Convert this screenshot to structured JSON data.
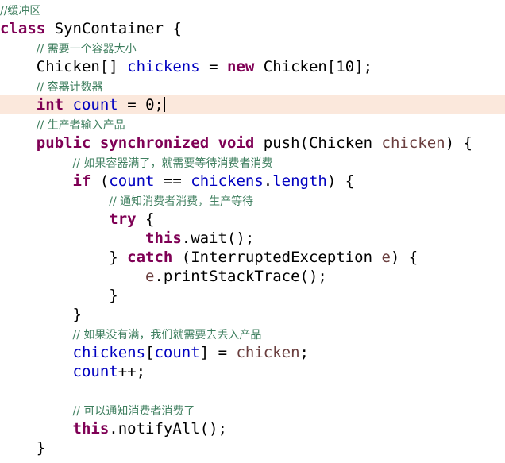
{
  "editor": {
    "lines": [
      {
        "tokens": [
          {
            "t": "//缓冲区",
            "c": "cmt"
          }
        ]
      },
      {
        "tokens": [
          {
            "t": "class",
            "c": "kw"
          },
          {
            "t": " SynContainer {",
            "c": "pln"
          }
        ]
      },
      {
        "tokens": [
          {
            "t": "    ",
            "c": "pln"
          },
          {
            "t": "// 需要一个容器大小",
            "c": "cmt"
          }
        ]
      },
      {
        "tokens": [
          {
            "t": "    Chicken[] ",
            "c": "pln"
          },
          {
            "t": "chickens",
            "c": "fld"
          },
          {
            "t": " = ",
            "c": "pln"
          },
          {
            "t": "new",
            "c": "kw"
          },
          {
            "t": " Chicken[10];",
            "c": "pln"
          }
        ]
      },
      {
        "tokens": [
          {
            "t": "    ",
            "c": "pln"
          },
          {
            "t": "// 容器计数器",
            "c": "cmt"
          }
        ]
      },
      {
        "tokens": [
          {
            "t": "    ",
            "c": "pln"
          },
          {
            "t": "int",
            "c": "kw"
          },
          {
            "t": " ",
            "c": "pln"
          },
          {
            "t": "count",
            "c": "fld"
          },
          {
            "t": " = 0;",
            "c": "pln"
          }
        ],
        "current": true,
        "caret": true
      },
      {
        "tokens": [
          {
            "t": "    ",
            "c": "pln"
          },
          {
            "t": "// 生产者输入产品",
            "c": "cmt"
          }
        ]
      },
      {
        "tokens": [
          {
            "t": "    ",
            "c": "pln"
          },
          {
            "t": "public",
            "c": "kw"
          },
          {
            "t": " ",
            "c": "pln"
          },
          {
            "t": "synchronized",
            "c": "kw"
          },
          {
            "t": " ",
            "c": "pln"
          },
          {
            "t": "void",
            "c": "kw"
          },
          {
            "t": " push(Chicken ",
            "c": "pln"
          },
          {
            "t": "chicken",
            "c": "loc"
          },
          {
            "t": ") {",
            "c": "pln"
          }
        ]
      },
      {
        "tokens": [
          {
            "t": "        ",
            "c": "pln"
          },
          {
            "t": "// 如果容器满了，就需要等待消费者消费",
            "c": "cmt"
          }
        ]
      },
      {
        "tokens": [
          {
            "t": "        ",
            "c": "pln"
          },
          {
            "t": "if",
            "c": "kw"
          },
          {
            "t": " (",
            "c": "pln"
          },
          {
            "t": "count",
            "c": "fld"
          },
          {
            "t": " == ",
            "c": "pln"
          },
          {
            "t": "chickens",
            "c": "fld"
          },
          {
            "t": ".",
            "c": "pln"
          },
          {
            "t": "length",
            "c": "fld"
          },
          {
            "t": ") {",
            "c": "pln"
          }
        ]
      },
      {
        "tokens": [
          {
            "t": "            ",
            "c": "pln"
          },
          {
            "t": "// 通知消费者消费，生产等待",
            "c": "cmt"
          }
        ]
      },
      {
        "tokens": [
          {
            "t": "            ",
            "c": "pln"
          },
          {
            "t": "try",
            "c": "kw"
          },
          {
            "t": " {",
            "c": "pln"
          }
        ]
      },
      {
        "tokens": [
          {
            "t": "                ",
            "c": "pln"
          },
          {
            "t": "this",
            "c": "kw"
          },
          {
            "t": ".wait();",
            "c": "pln"
          }
        ]
      },
      {
        "tokens": [
          {
            "t": "            } ",
            "c": "pln"
          },
          {
            "t": "catch",
            "c": "kw"
          },
          {
            "t": " (InterruptedException ",
            "c": "pln"
          },
          {
            "t": "e",
            "c": "loc"
          },
          {
            "t": ") {",
            "c": "pln"
          }
        ]
      },
      {
        "tokens": [
          {
            "t": "                ",
            "c": "pln"
          },
          {
            "t": "e",
            "c": "loc"
          },
          {
            "t": ".printStackTrace();",
            "c": "pln"
          }
        ]
      },
      {
        "tokens": [
          {
            "t": "            }",
            "c": "pln"
          }
        ]
      },
      {
        "tokens": [
          {
            "t": "        }",
            "c": "pln"
          }
        ]
      },
      {
        "tokens": [
          {
            "t": "        ",
            "c": "pln"
          },
          {
            "t": "// 如果没有满，我们就需要去丢入产品",
            "c": "cmt"
          }
        ]
      },
      {
        "tokens": [
          {
            "t": "        ",
            "c": "pln"
          },
          {
            "t": "chickens",
            "c": "fld"
          },
          {
            "t": "[",
            "c": "pln"
          },
          {
            "t": "count",
            "c": "fld"
          },
          {
            "t": "] = ",
            "c": "pln"
          },
          {
            "t": "chicken",
            "c": "loc"
          },
          {
            "t": ";",
            "c": "pln"
          }
        ]
      },
      {
        "tokens": [
          {
            "t": "        ",
            "c": "pln"
          },
          {
            "t": "count",
            "c": "fld"
          },
          {
            "t": "++;",
            "c": "pln"
          }
        ]
      },
      {
        "tokens": []
      },
      {
        "tokens": [
          {
            "t": "        ",
            "c": "pln"
          },
          {
            "t": "// 可以通知消费者消费了",
            "c": "cmt"
          }
        ]
      },
      {
        "tokens": [
          {
            "t": "        ",
            "c": "pln"
          },
          {
            "t": "this",
            "c": "kw"
          },
          {
            "t": ".notifyAll();",
            "c": "pln"
          }
        ]
      },
      {
        "tokens": [
          {
            "t": "    }",
            "c": "pln"
          }
        ]
      }
    ]
  }
}
